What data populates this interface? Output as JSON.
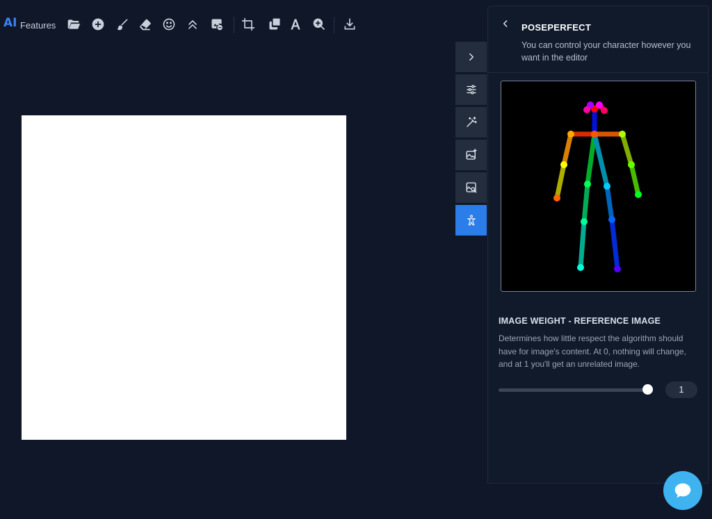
{
  "toolbar": {
    "ai_label": "AI",
    "features_label": "Features",
    "tools": [
      {
        "name": "folder-open-icon"
      },
      {
        "name": "add-circle-icon"
      },
      {
        "name": "brush-icon"
      },
      {
        "name": "eraser-icon"
      },
      {
        "name": "emoji-icon"
      },
      {
        "name": "chevrons-up-icon"
      },
      {
        "name": "remove-background-icon"
      },
      {
        "name": "crop-icon"
      },
      {
        "name": "layers-icon"
      },
      {
        "name": "text-icon"
      },
      {
        "name": "zoom-in-icon"
      },
      {
        "name": "download-icon"
      }
    ]
  },
  "side_tabs": [
    {
      "name": "expand-chevron-icon",
      "active": false
    },
    {
      "name": "sliders-icon",
      "active": false
    },
    {
      "name": "magic-wand-icon",
      "active": false
    },
    {
      "name": "image-sparkle-icon",
      "active": false
    },
    {
      "name": "image-search-icon",
      "active": false
    },
    {
      "name": "pose-figure-icon",
      "active": true
    }
  ],
  "panel": {
    "title": "POSEPERFECT",
    "subtitle": "You can control your character however you want in the editor",
    "weight_title": "IMAGE WEIGHT - REFERENCE IMAGE",
    "weight_description": "Determines how little respect the algorithm should have for image's content. At 0, nothing will change, and at 1 you'll get an unrelated image.",
    "weight_value": "1",
    "weight_fraction": 1.0
  },
  "colors": {
    "background": "#0f1729",
    "accent": "#2b7de9",
    "chat": "#3fb3ef"
  }
}
